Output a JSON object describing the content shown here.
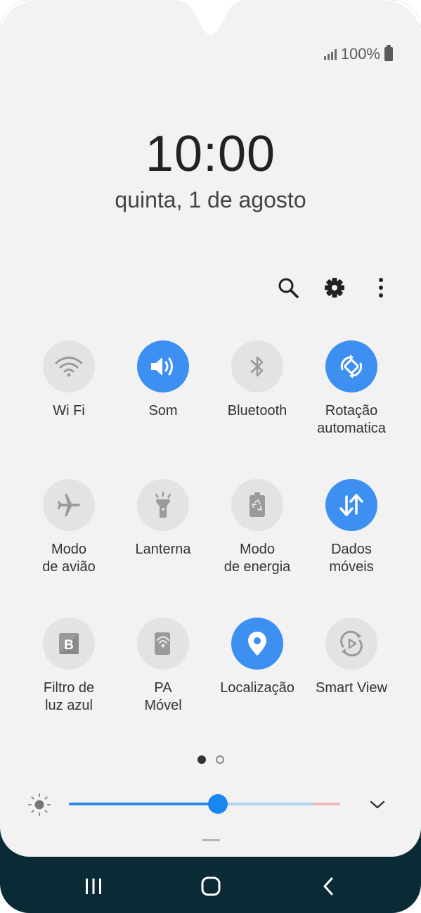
{
  "status_bar": {
    "battery_text": "100%",
    "icons": [
      "signal-icon",
      "battery-icon"
    ]
  },
  "lock": {
    "time": "10:00",
    "date": "quinta, 1 de agosto"
  },
  "toolbar": {
    "icons": [
      "search-icon",
      "settings-gear-icon",
      "more-vertical-icon"
    ]
  },
  "tiles": [
    {
      "label": "Wi Fi",
      "icon": "wifi-icon",
      "on": false
    },
    {
      "label": "Som",
      "icon": "sound-icon",
      "on": true
    },
    {
      "label": "Bluetooth",
      "icon": "bluetooth-icon",
      "on": false
    },
    {
      "label": "Rotação\nautomatica",
      "icon": "auto-rotate-icon",
      "on": true
    },
    {
      "label": "Modo\nde avião",
      "icon": "airplane-icon",
      "on": false
    },
    {
      "label": "Lanterna",
      "icon": "flashlight-icon",
      "on": false
    },
    {
      "label": "Modo\nde energia",
      "icon": "power-mode-icon",
      "on": false
    },
    {
      "label": "Dados\nmóveis",
      "icon": "mobile-data-icon",
      "on": true
    },
    {
      "label": "Filtro de\nluz azul",
      "icon": "blue-light-filter-icon",
      "on": false
    },
    {
      "label": "PA\nMóvel",
      "icon": "mobile-hotspot-icon",
      "on": false
    },
    {
      "label": "Localização",
      "icon": "location-icon",
      "on": true
    },
    {
      "label": "Smart View",
      "icon": "smart-view-icon",
      "on": false
    }
  ],
  "pagination": {
    "current": 1,
    "total": 2
  },
  "brightness": {
    "level": 0.55
  },
  "colors": {
    "accent": "#3d8ff2",
    "panel_bg": "#f2f2f2",
    "tile_off": "#e3e3e3",
    "navbar_bg": "#0a2a36"
  },
  "navbar": {
    "icons": [
      "recent-apps-icon",
      "home-icon",
      "back-icon"
    ]
  }
}
